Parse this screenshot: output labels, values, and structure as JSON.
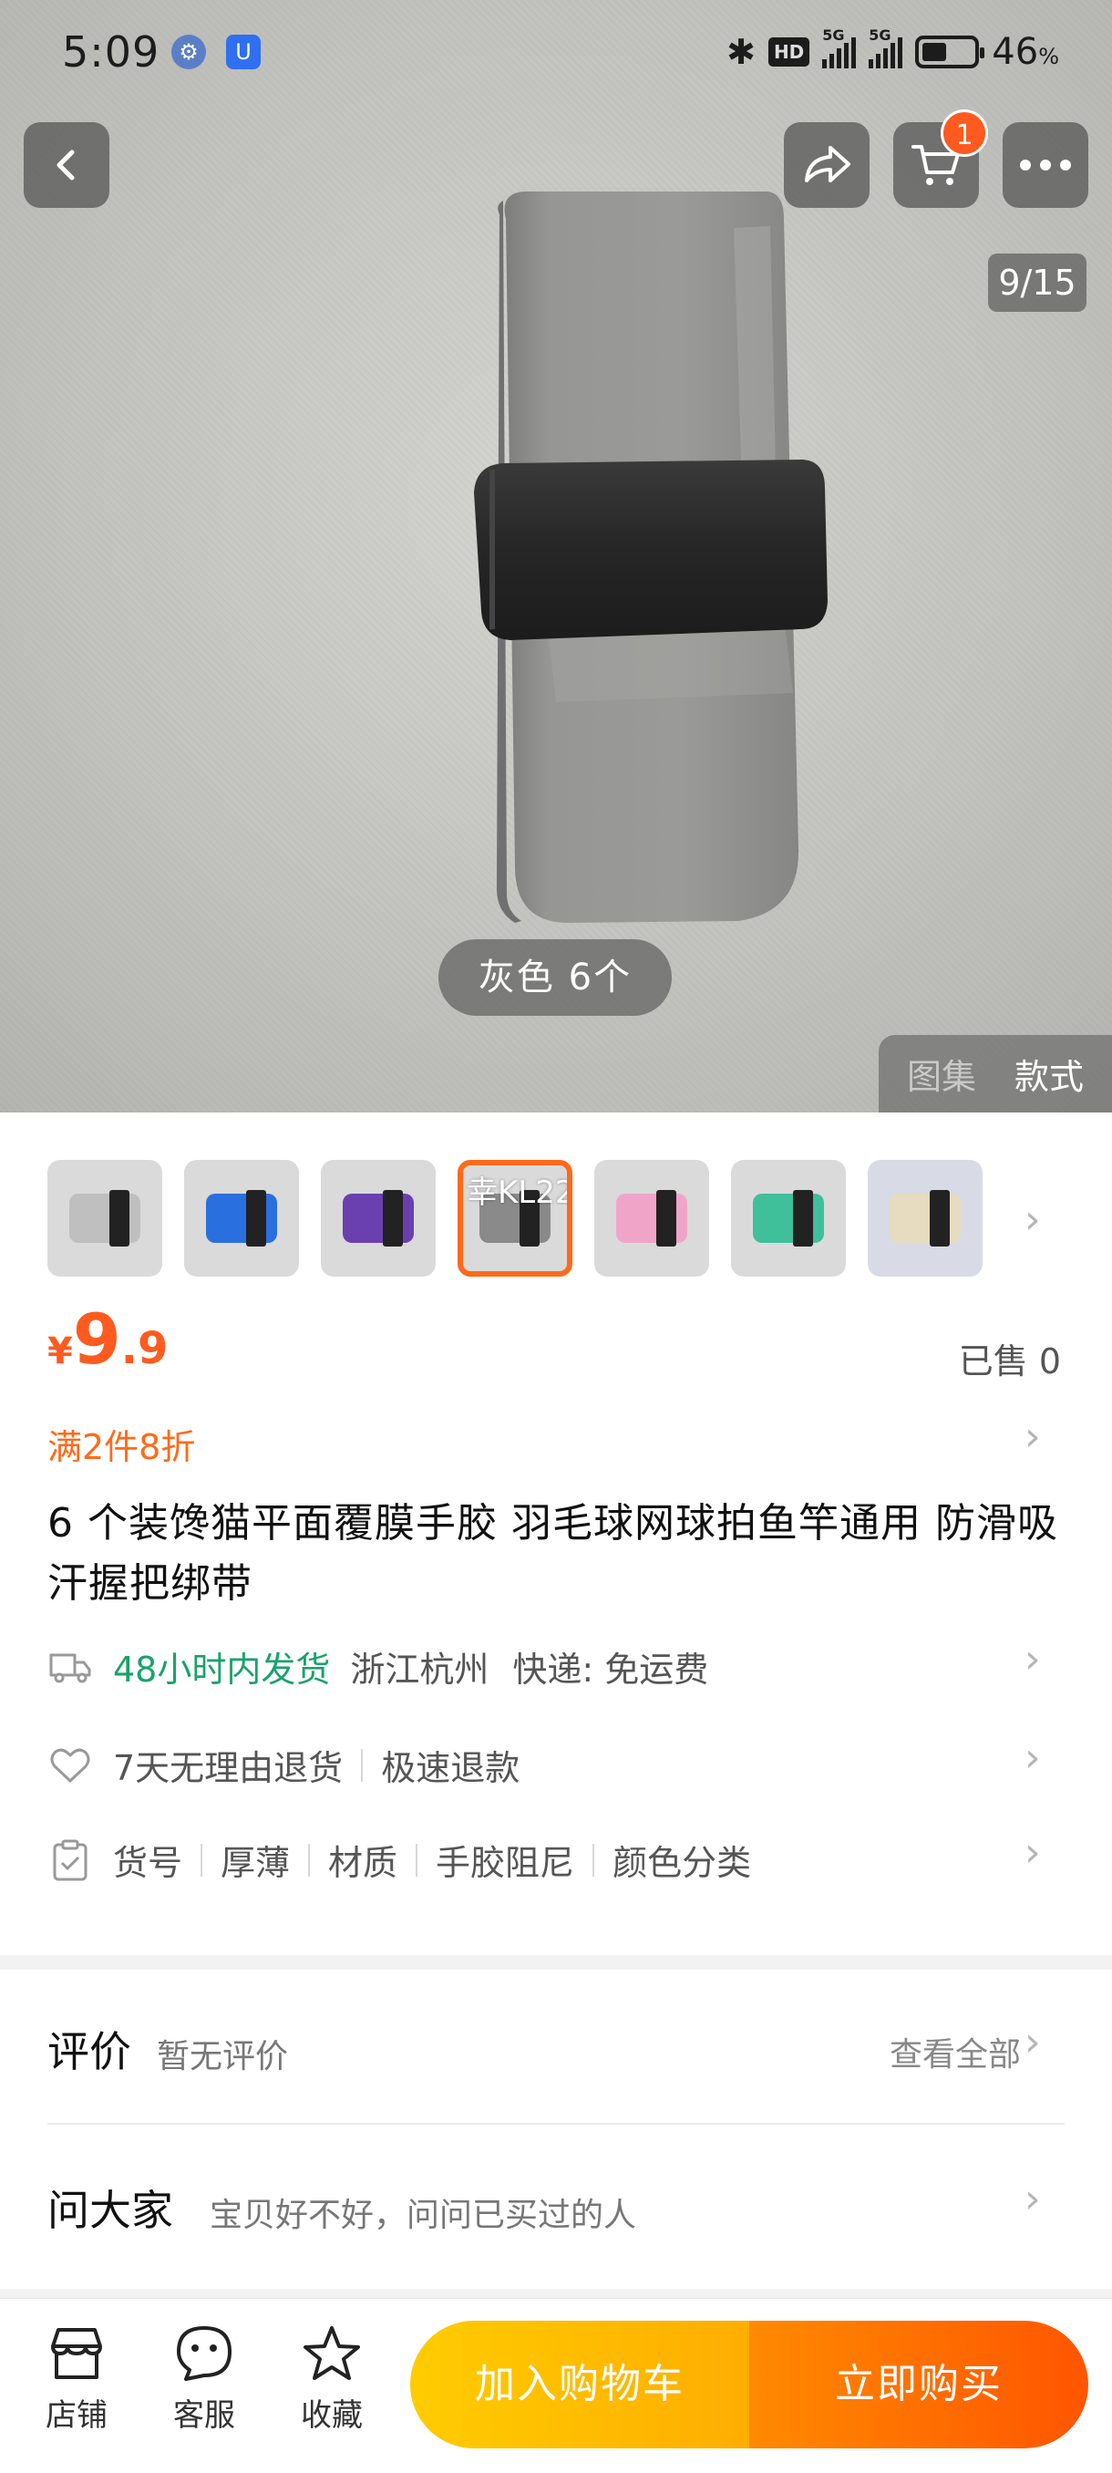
{
  "status_bar": {
    "time": "5:09",
    "battery_percent": "46",
    "battery_unit": "%",
    "network": "5G",
    "hd_badge": "HD"
  },
  "header": {
    "cart_count": "1",
    "image_index": "9/15"
  },
  "hero": {
    "variant_label": "灰色 6个",
    "tabs": [
      "图集",
      "款式"
    ],
    "active_tab": "款式"
  },
  "variants": [
    {
      "color": "#bfbfbf"
    },
    {
      "color": "#2a6fe0"
    },
    {
      "color": "#6a3fb0"
    },
    {
      "color": "#8a8a8a",
      "tag": "幸KL22",
      "selected": true
    },
    {
      "color": "#f0a5c8"
    },
    {
      "color": "#3fbf9a"
    },
    {
      "color": "#e7dcc0"
    }
  ],
  "product": {
    "currency": "¥",
    "price_int": "9",
    "price_dec": ".9",
    "sold": "已售 0",
    "promo": "满2件8折",
    "title": "6 个装馋猫平面覆膜手胶 羽毛球网球拍鱼竿通用 防滑吸汗握把绑带"
  },
  "shipping": {
    "delivery": "48小时内发货",
    "location": "浙江杭州",
    "express": "快递:  免运费"
  },
  "service": {
    "return": "7天无理由退货",
    "refund": "极速退款"
  },
  "params": [
    "货号",
    "厚薄",
    "材质",
    "手胶阻尼",
    "颜色分类"
  ],
  "reviews": {
    "title": "评价",
    "subtitle": "暂无评价",
    "view_all": "查看全部"
  },
  "ask": {
    "title": "问大家",
    "subtitle": "宝贝好不好，问问已买过的人"
  },
  "bottom_bar": {
    "store": "店铺",
    "service": "客服",
    "favorite": "收藏",
    "add_to_cart": "加入购物车",
    "buy_now": "立即购买"
  },
  "colors": {
    "accent_orange": "#ff5a1f",
    "green": "#1aa26a",
    "cart_button": "#ffb800",
    "buy_button": "#ff6a00"
  }
}
